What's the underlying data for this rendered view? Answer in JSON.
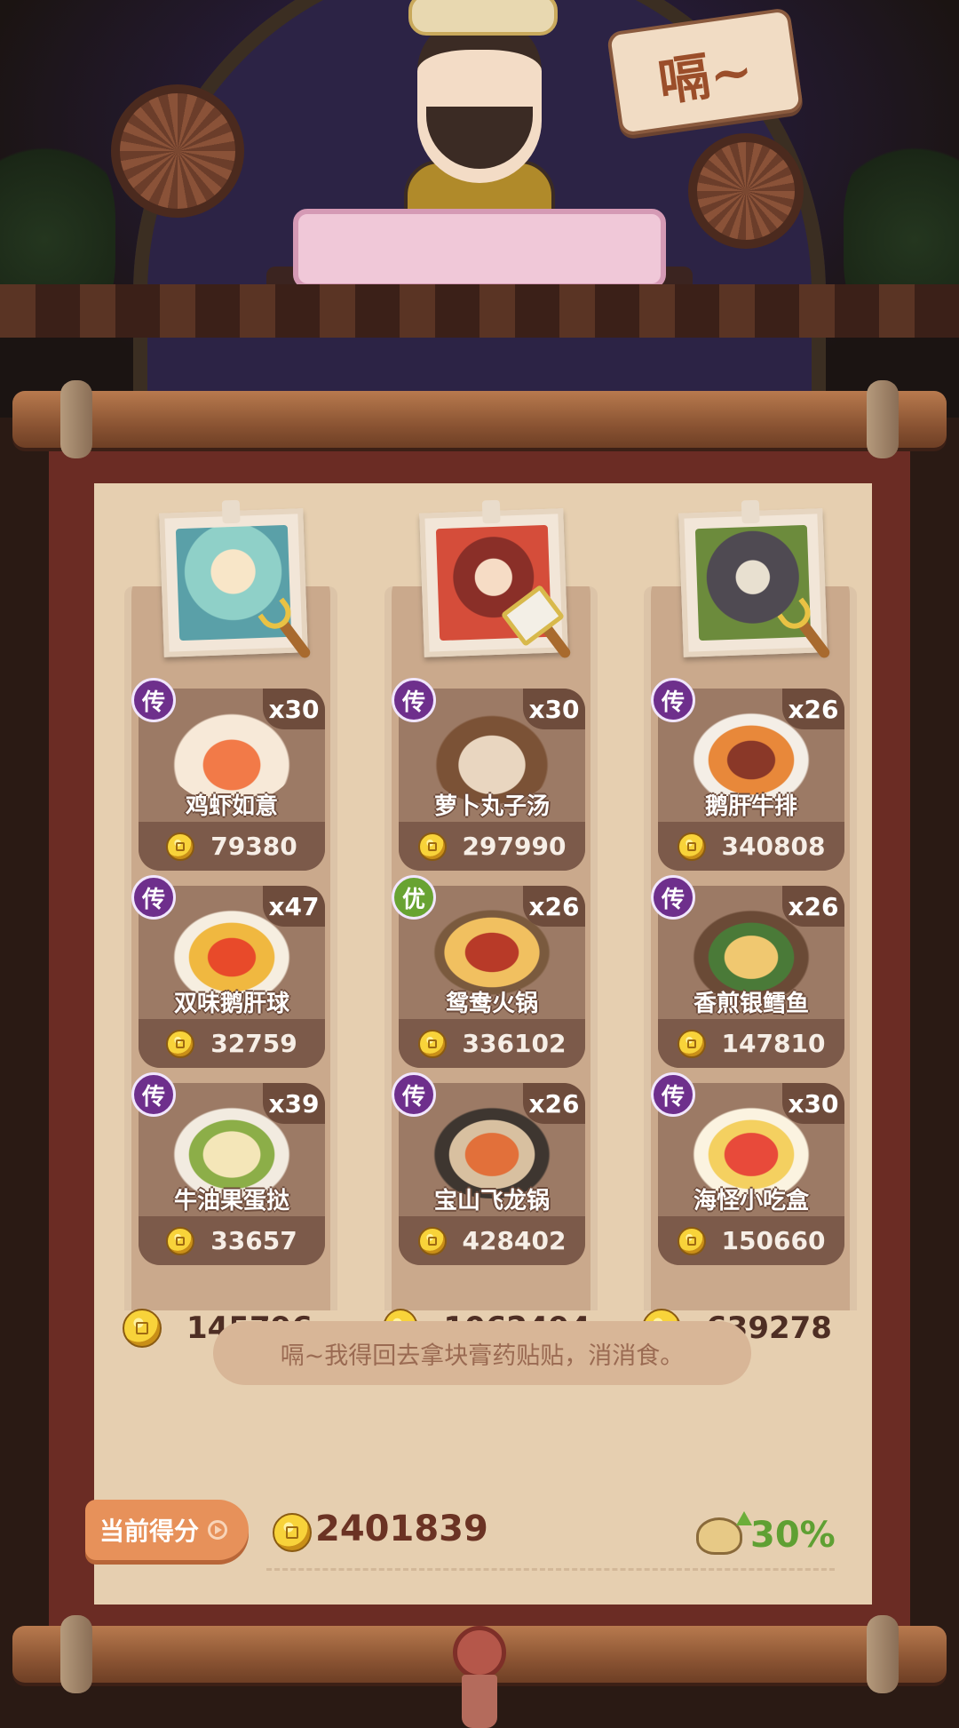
{
  "scene": {
    "sign_text": "嗝~"
  },
  "columns": [
    {
      "dishes": [
        {
          "rank": "传",
          "qty": "x30",
          "name": "鸡虾如意",
          "price": "79380"
        },
        {
          "rank": "传",
          "qty": "x47",
          "name": "双味鹅肝球",
          "price": "32759"
        },
        {
          "rank": "传",
          "qty": "x39",
          "name": "牛油果蛋挞",
          "price": "33657"
        }
      ],
      "total": "145796"
    },
    {
      "dishes": [
        {
          "rank": "传",
          "qty": "x30",
          "name": "萝卜丸子汤",
          "price": "297990"
        },
        {
          "rank": "优",
          "qty": "x26",
          "name": "鸳鸯火锅",
          "price": "336102"
        },
        {
          "rank": "传",
          "qty": "x26",
          "name": "宝山飞龙锅",
          "price": "428402"
        }
      ],
      "total": "1062494"
    },
    {
      "dishes": [
        {
          "rank": "传",
          "qty": "x26",
          "name": "鹅肝牛排",
          "price": "340808"
        },
        {
          "rank": "传",
          "qty": "x26",
          "name": "香煎银鳕鱼",
          "price": "147810"
        },
        {
          "rank": "传",
          "qty": "x30",
          "name": "海怪小吃盒",
          "price": "150660"
        }
      ],
      "total": "639278"
    }
  ],
  "speech": "嗝~我得回去拿块膏药贴贴，消消食。",
  "score": {
    "tab_label": "当前得分",
    "value": "2401839",
    "bonus": "30%"
  },
  "colors": {
    "rank_legend": "#6e2f8c",
    "rank_excellent": "#68a332",
    "bonus_green": "#5fa033",
    "score_tab": "#e7915a"
  },
  "icons": {
    "coin": "coin-icon",
    "fork": "fork-icon",
    "cleaver": "cleaver-icon",
    "bonus": "full-belly-icon"
  }
}
